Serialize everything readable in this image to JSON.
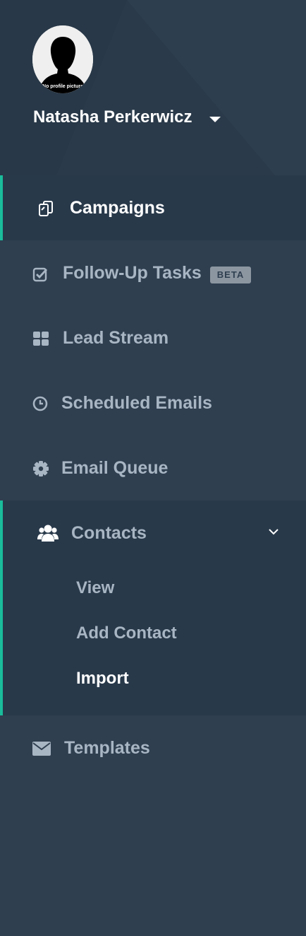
{
  "profile": {
    "user_name": "Natasha Perkerwicz",
    "avatar_caption": "No profile picture"
  },
  "nav": {
    "campaigns": "Campaigns",
    "follow_up_tasks": "Follow-Up Tasks",
    "follow_up_badge": "BETA",
    "lead_stream": "Lead Stream",
    "scheduled_emails": "Scheduled Emails",
    "email_queue": "Email Queue",
    "contacts": "Contacts",
    "contacts_sub": {
      "view": "View",
      "add_contact": "Add Contact",
      "import": "Import"
    },
    "templates": "Templates"
  },
  "colors": {
    "background": "#2f3f50",
    "active_background": "#28394a",
    "accent": "#1abc9c",
    "text_active": "#ffffff",
    "text_muted": "#a8b5c3"
  }
}
